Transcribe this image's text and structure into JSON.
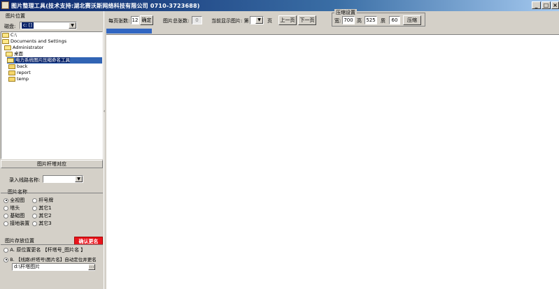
{
  "window": {
    "title": "图片整理工具(技术支持:湖北赛沃斯网络科技有限公司 0710-3723688)",
    "controls": [
      "_",
      "□",
      "×"
    ]
  },
  "left": {
    "image_location_label": "图片位置",
    "drive_label": "磁盘:",
    "drive_value": "c: []",
    "tree": [
      {
        "label": "C:\\",
        "level": 0,
        "open": true
      },
      {
        "label": "Documents and Settings",
        "level": 0,
        "open": true
      },
      {
        "label": "Administrator",
        "level": 1,
        "open": true
      },
      {
        "label": "桌面",
        "level": 1,
        "open": true
      },
      {
        "label": "电力系统图片压缩命名工具",
        "level": 2,
        "open": true,
        "selected": true
      },
      {
        "label": "back",
        "level": 3,
        "open": false
      },
      {
        "label": "report",
        "level": 3,
        "open": false
      },
      {
        "label": "temp",
        "level": 3,
        "open": false
      }
    ],
    "pole_match_header": "图片杆塔对应",
    "line_name_label": "录入线路名称:",
    "line_name_value": "",
    "image_name_label": "图片名称",
    "image_names": [
      {
        "label": "全视图",
        "checked": true
      },
      {
        "label": "杆号牌",
        "checked": false
      },
      {
        "label": "塔头",
        "checked": false
      },
      {
        "label": "其它1",
        "checked": false
      },
      {
        "label": "基础图",
        "checked": false
      },
      {
        "label": "其它2",
        "checked": false
      },
      {
        "label": "接地装置",
        "checked": false
      },
      {
        "label": "其它3",
        "checked": false
      }
    ],
    "storage_label": "图片存放位置",
    "confirm_rename": "确认更名",
    "option_a": "A. 原位置更名 【杆塔号_图片名 】",
    "option_b": "B. 【线路\\杆塔号\\图片名】自动定位并更名",
    "option_a_checked": false,
    "option_b_checked": true,
    "path_value": "d:\\杆塔图片"
  },
  "toolbar": {
    "per_page_label": "每页张数:",
    "per_page_value": "12",
    "confirm_button": "确定",
    "total_label": "图片总张数:",
    "total_value": "0",
    "current_label": "当前显示图片: 第",
    "current_value": "",
    "page_suffix": "页",
    "prev_button": "上一页",
    "next_button": "下一页",
    "compress_group_title": "压缩设置",
    "width_label": "宽:",
    "width_value": "700",
    "height_label": "高",
    "height_value": "525",
    "quality_label": "质",
    "quality_value": "60",
    "compress_button": "压缩"
  },
  "progress": {
    "fraction": 0.1
  }
}
